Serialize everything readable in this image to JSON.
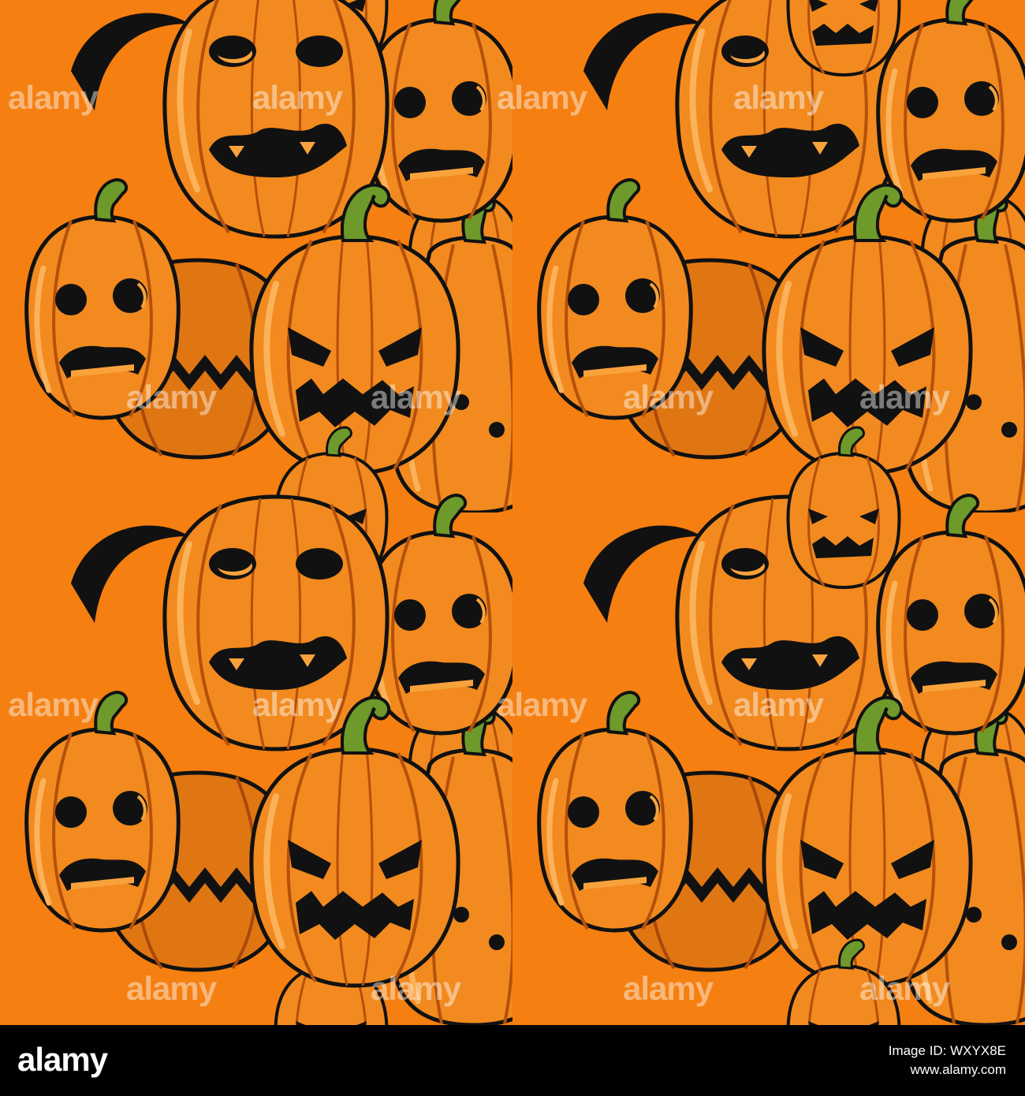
{
  "colors": {
    "background": "#f57f10",
    "pumpkin_light": "#f9a23c",
    "pumpkin_main": "#f28a1f",
    "pumpkin_dark": "#c9560c",
    "outline": "#111111",
    "stem": "#6d9a2a",
    "stem_dark": "#3c5e14",
    "footer": "#000000"
  },
  "artwork": {
    "subject": "jack-o-lantern-pumpkin-pattern",
    "face_types": [
      "surprised-oval-eyes",
      "angry-slanted-eyes",
      "round-eyed-frown",
      "zigzag-mouth",
      "tall-gourd"
    ]
  },
  "watermark": {
    "text": "alamy"
  },
  "footer": {
    "logo": "alamy",
    "image_id_label": "Image ID: WXYX8E",
    "site": "www.alamy.com"
  }
}
